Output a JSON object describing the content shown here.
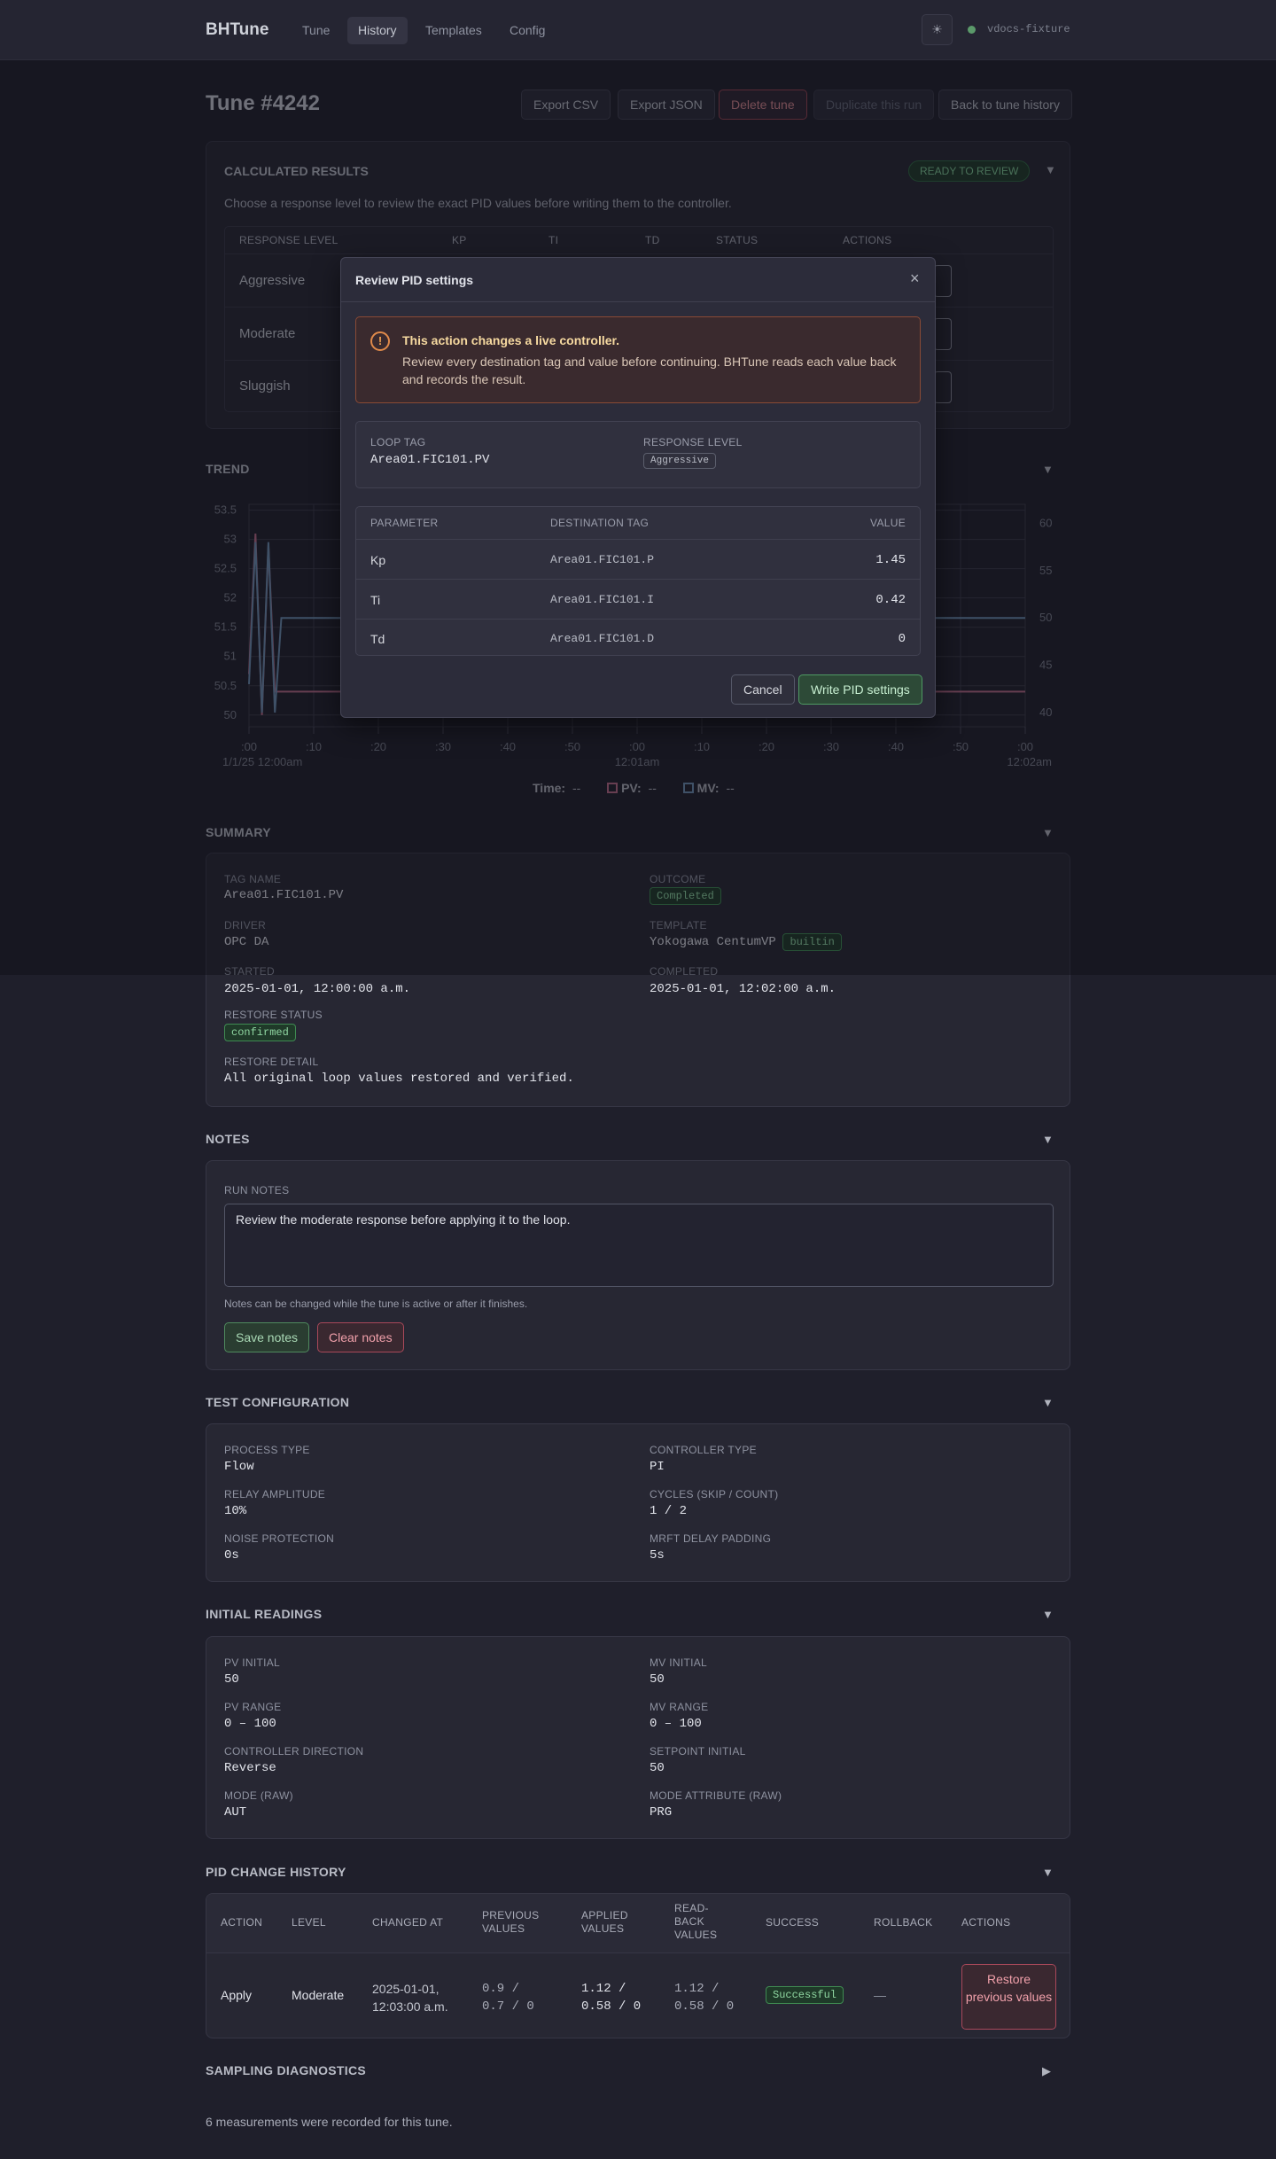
{
  "nav": {
    "brand": "BHTune",
    "links": [
      "Tune",
      "History",
      "Templates",
      "Config"
    ],
    "active": "History",
    "theme_icon": "sun-icon",
    "fixture": "vdocs-fixture"
  },
  "header": {
    "title": "Tune #4242",
    "buttons": [
      "Export CSV",
      "Export JSON",
      "Delete tune",
      "Duplicate this run",
      "Back to tune history"
    ]
  },
  "calc": {
    "title": "CALCULATED RESULTS",
    "badge": "READY TO REVIEW",
    "desc": "Choose a response level to review the exact PID values before writing them to the controller.",
    "columns": [
      "RESPONSE LEVEL",
      "KP",
      "TI",
      "TD",
      "STATUS",
      "ACTIONS"
    ],
    "rows": [
      "Aggressive",
      "Moderate",
      "Sluggish"
    ]
  },
  "trend": {
    "title": "TREND",
    "legend_time_label": "Time:",
    "legend_time_value": "--",
    "legend_pv_label": "PV:",
    "legend_pv_value": "--",
    "legend_mv_label": "MV:",
    "legend_mv_value": "--"
  },
  "chart_data": {
    "type": "line",
    "y_left_ticks": [
      "53.5",
      "53",
      "52.5",
      "52",
      "51.5",
      "51",
      "50.5",
      "50"
    ],
    "y_right_ticks": [
      "60",
      "55",
      "50",
      "45",
      "40"
    ],
    "x_ticks": [
      ":00",
      ":10",
      ":20",
      ":30",
      ":40",
      ":50",
      ":00",
      ":10",
      ":20",
      ":30",
      ":40",
      ":50",
      ":00"
    ],
    "x_date_labels": [
      "1/1/25 12:00am",
      "12:01am",
      "12:02am"
    ],
    "ylim_left": [
      49.8,
      53.6
    ],
    "ylim_right": [
      38.5,
      62
    ],
    "series": [
      {
        "name": "PV",
        "axis": "left",
        "color": "#b86a86",
        "x": [
          0,
          1,
          2,
          3,
          4,
          5,
          6,
          120
        ],
        "y": [
          50.7,
          53.1,
          50.0,
          52.9,
          50.4,
          50.4,
          50.4,
          50.4
        ]
      },
      {
        "name": "MV",
        "axis": "right",
        "color": "#6b8fb0",
        "x": [
          0,
          1,
          2,
          3,
          4,
          5,
          6,
          120
        ],
        "y": [
          43,
          58,
          40,
          58,
          40,
          50,
          50,
          50
        ]
      }
    ]
  },
  "modal": {
    "title": "Review PID settings",
    "close_icon": "close-icon",
    "warning_icon": "warning-icon",
    "warning_title": "This action changes a live controller.",
    "warning_text": "Review every destination tag and value before continuing. BHTune reads each value back and records the result.",
    "loop_tag_label": "LOOP TAG",
    "loop_tag": "Area01.FIC101.PV",
    "response_label": "RESPONSE LEVEL",
    "response": "Aggressive",
    "col_param": "PARAMETER",
    "col_dest": "DESTINATION TAG",
    "col_value": "VALUE",
    "rows": [
      {
        "param": "Kp",
        "dest": "Area01.FIC101.P",
        "value": "1.45"
      },
      {
        "param": "Ti",
        "dest": "Area01.FIC101.I",
        "value": "0.42"
      },
      {
        "param": "Td",
        "dest": "Area01.FIC101.D",
        "value": "0"
      }
    ],
    "cancel": "Cancel",
    "write": "Write PID settings"
  },
  "summary": {
    "title": "SUMMARY",
    "tag_name_label": "TAG NAME",
    "tag_name": "Area01.FIC101.PV",
    "outcome_label": "OUTCOME",
    "outcome": "Completed",
    "driver_label": "DRIVER",
    "driver": "OPC DA",
    "template_label": "TEMPLATE",
    "template": "Yokogawa CentumVP",
    "template_badge": "builtin",
    "started_label": "STARTED",
    "started": "2025-01-01, 12:00:00 a.m.",
    "completed_label": "COMPLETED",
    "completed": "2025-01-01, 12:02:00 a.m.",
    "restore_status_label": "RESTORE STATUS",
    "restore_status": "confirmed",
    "restore_detail_label": "RESTORE DETAIL",
    "restore_detail": "All original loop values restored and verified."
  },
  "notes": {
    "title": "NOTES",
    "label": "RUN NOTES",
    "value": "Review the moderate response before applying it to the loop.",
    "hint": "Notes can be changed while the tune is active or after it finishes.",
    "save": "Save notes",
    "clear": "Clear notes"
  },
  "config": {
    "title": "TEST CONFIGURATION",
    "items": [
      {
        "label": "PROCESS TYPE",
        "value": "Flow"
      },
      {
        "label": "CONTROLLER TYPE",
        "value": "PI"
      },
      {
        "label": "RELAY AMPLITUDE",
        "value": "10%"
      },
      {
        "label": "CYCLES (SKIP / COUNT)",
        "value": "1 / 2"
      },
      {
        "label": "NOISE PROTECTION",
        "value": "0s"
      },
      {
        "label": "MRFT DELAY PADDING",
        "value": "5s"
      }
    ]
  },
  "readings": {
    "title": "INITIAL READINGS",
    "items": [
      {
        "label": "PV INITIAL",
        "value": "50"
      },
      {
        "label": "MV INITIAL",
        "value": "50"
      },
      {
        "label": "PV RANGE",
        "value": "0 – 100"
      },
      {
        "label": "MV RANGE",
        "value": "0 – 100"
      },
      {
        "label": "CONTROLLER DIRECTION",
        "value": "Reverse"
      },
      {
        "label": "SETPOINT INITIAL",
        "value": "50"
      },
      {
        "label": "MODE (RAW)",
        "value": "AUT"
      },
      {
        "label": "MODE ATTRIBUTE (RAW)",
        "value": "PRG"
      }
    ]
  },
  "history": {
    "title": "PID CHANGE HISTORY",
    "columns": [
      "ACTION",
      "LEVEL",
      "CHANGED AT",
      "PREVIOUS VALUES",
      "APPLIED VALUES",
      "READ-BACK VALUES",
      "SUCCESS",
      "ROLLBACK",
      "ACTIONS"
    ],
    "row": {
      "action": "Apply",
      "level": "Moderate",
      "changed_at": "2025-01-01, 12:03:00 a.m.",
      "previous": "0.9 / 0.7 / 0",
      "applied": "1.12 / 0.58 / 0",
      "readback": "1.12 / 0.58 / 0",
      "success": "Successful",
      "rollback": "—",
      "restore": "Restore previous values"
    }
  },
  "sampling": {
    "title": "SAMPLING DIAGNOSTICS",
    "text": "6 measurements were recorded for this tune."
  }
}
